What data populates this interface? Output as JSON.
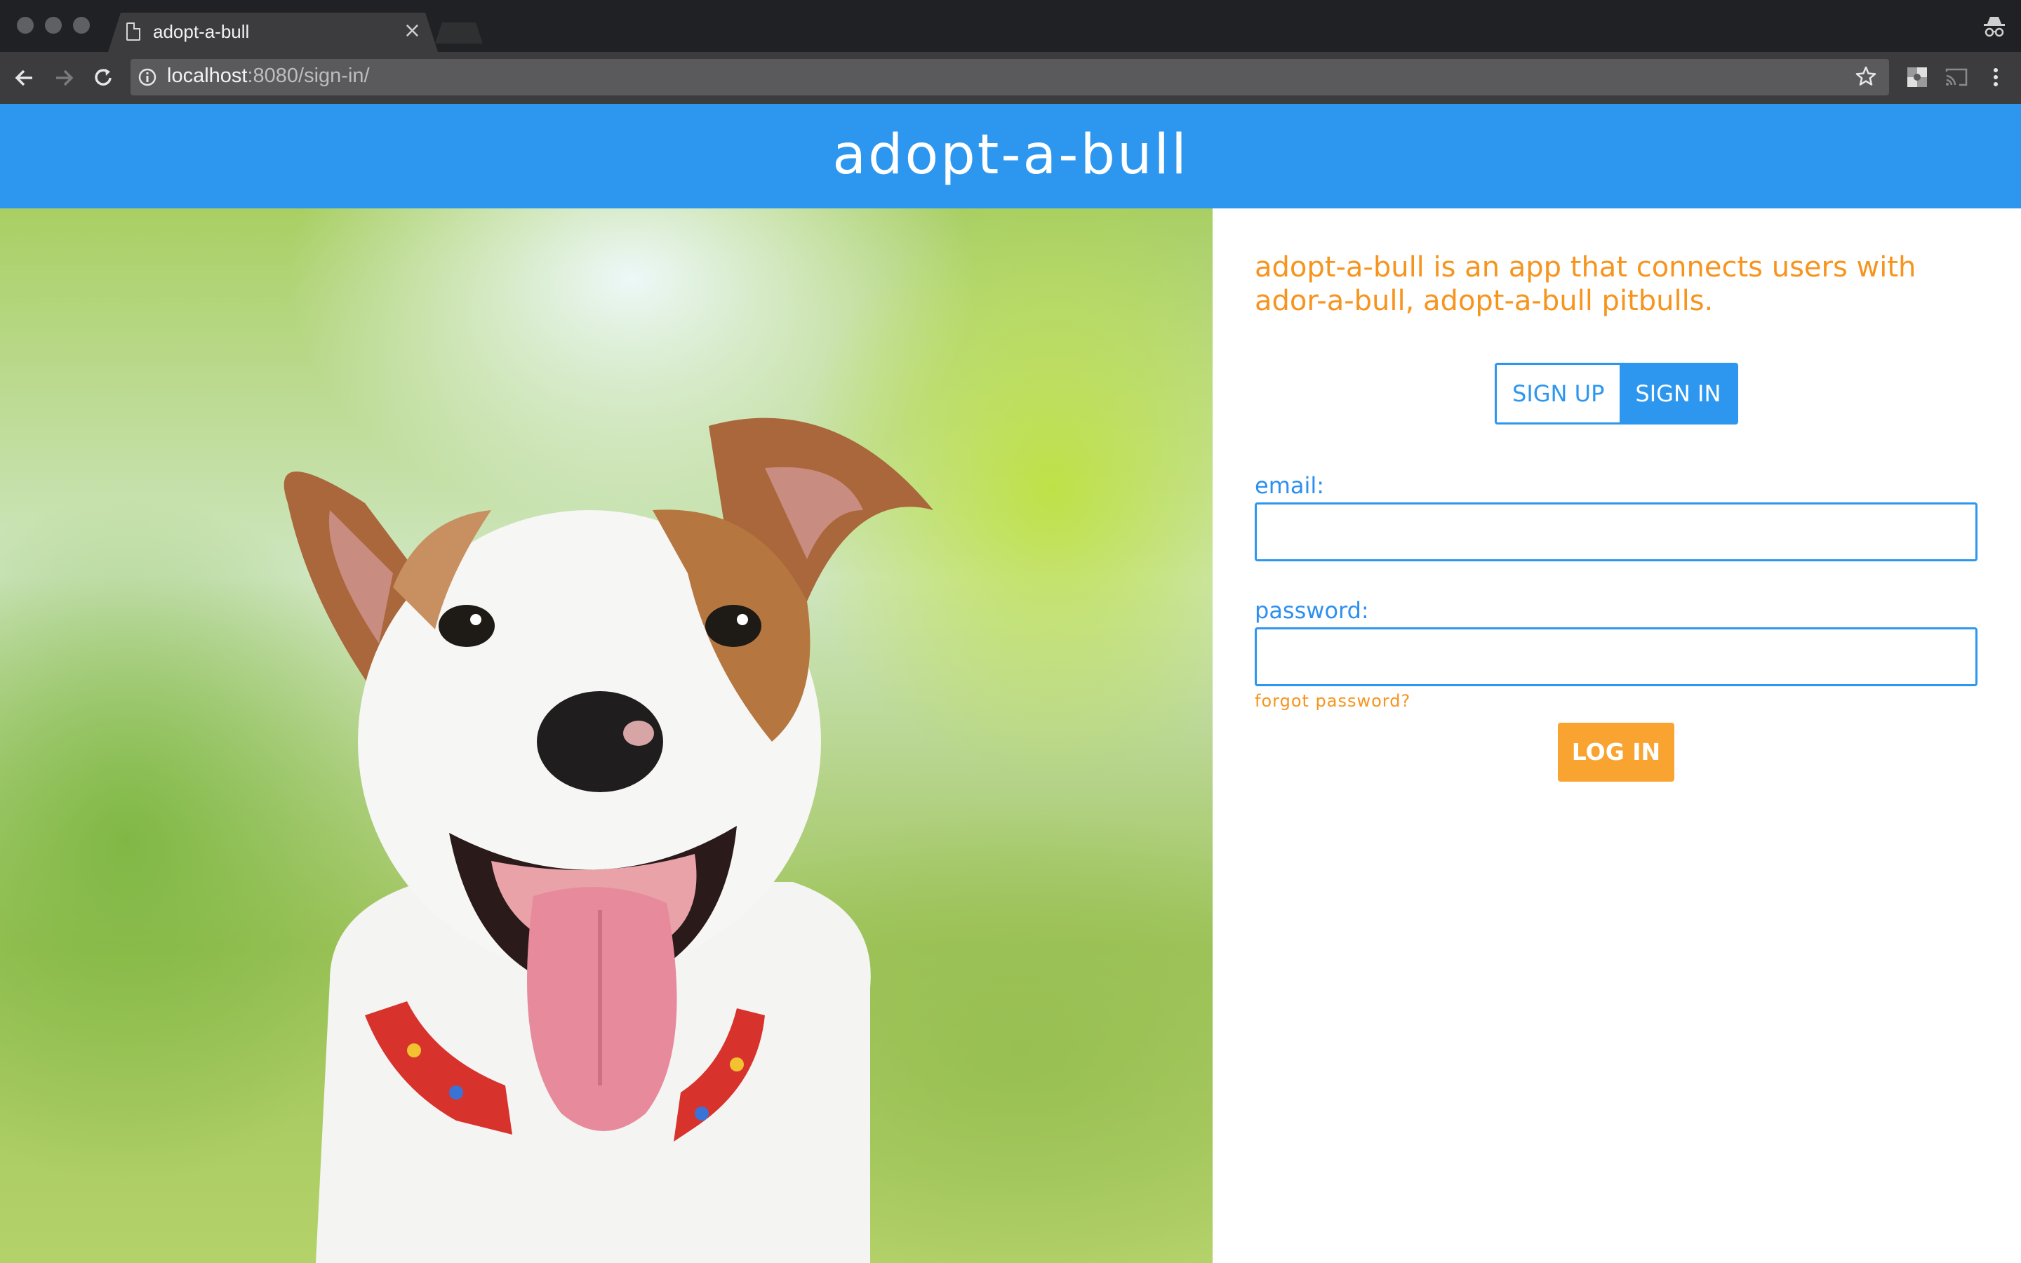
{
  "browser": {
    "tab_title": "adopt-a-bull",
    "tab_close": "×",
    "url_host": "localhost",
    "url_rest": ":8080/sign-in/"
  },
  "header": {
    "logo": "adopt-a-bull"
  },
  "hero": {
    "image_desc": "puppy-photo"
  },
  "auth": {
    "tagline": "adopt-a-bull is an app that connects users with ador-a-bull, adopt-a-bull pitbulls.",
    "signup_label": "SIGN UP",
    "signin_label": "SIGN IN",
    "email_label": "email:",
    "email_value": "",
    "password_label": "password:",
    "password_value": "",
    "forgot_label": "forgot password?",
    "login_label": "LOG IN"
  },
  "colors": {
    "brand_blue": "#2d97ef",
    "accent_orange": "#f7941d",
    "login_orange": "#f9a330"
  }
}
